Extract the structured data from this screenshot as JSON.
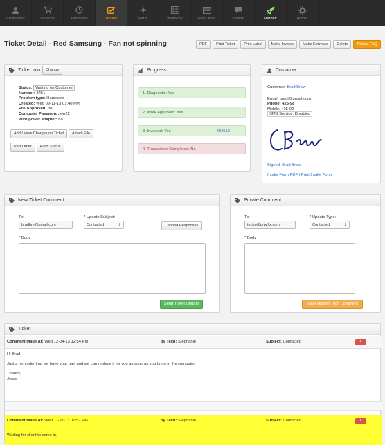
{
  "nav": [
    {
      "label": "Customers",
      "icon": "user-icon"
    },
    {
      "label": "Invoices",
      "icon": "cart-icon"
    },
    {
      "label": "Estimates",
      "icon": "clock-icon"
    },
    {
      "label": "Tickets",
      "icon": "checkbox-icon",
      "active": true
    },
    {
      "label": "Parts",
      "icon": "plane-icon"
    },
    {
      "label": "Inventory",
      "icon": "grid-icon"
    },
    {
      "label": "Field Jobs",
      "icon": "calendar-icon"
    },
    {
      "label": "Leads",
      "icon": "chat-icon"
    },
    {
      "label": "Marketr",
      "icon": "rocket-icon"
    },
    {
      "label": "Admin",
      "icon": "gear-icon"
    }
  ],
  "page": {
    "title": "Ticket Detail - Red Samsung - Fan not spinning"
  },
  "toolbar": [
    "PDF",
    "Print Ticket",
    "Print Label",
    "Make Invoice",
    "Make Estimate",
    "Delete",
    "Tickets FAQ"
  ],
  "ticket_info": {
    "header": "Ticket Info",
    "change": "Change",
    "status_label": "Status:",
    "status_value": "Waiting on Customer",
    "number_label": "Number:",
    "number_value": "3451",
    "problem_label": "Problem type:",
    "problem_value": "Hardware",
    "created_label": "Created:",
    "created_value": "Wed 09-11-13 01:40 PM",
    "preapproved_label": "Pre-Approved:",
    "preapproved_value": "no",
    "password_label": "Computer Password:",
    "password_value": "ew22",
    "adapter_label": "With power adapter:",
    "adapter_value": "no",
    "btn_charges": "Add / View Charges on Ticket",
    "btn_attach": "Attach File",
    "btn_order": "Part Order",
    "btn_status": "Parts Status"
  },
  "progress": {
    "header": "Progress",
    "steps": [
      {
        "label": "1. Diagnostic: Yes",
        "state": "done"
      },
      {
        "label": "2. Work Approved: Yes",
        "state": "done"
      },
      {
        "label": "3. Invoiced: Yes",
        "state": "done",
        "link": "204512"
      },
      {
        "label": "4. Transaction Completed: No",
        "state": "pending"
      }
    ]
  },
  "customer": {
    "header": "Customer",
    "customer_label": "Customer:",
    "customer_name": "Brad Brew",
    "email_label": "Email:",
    "email_value": "bradl@gmail.com",
    "phone_label": "Phone:",
    "phone_value": "425-98",
    "mobile_label": "Mobile:",
    "mobile_value": "425-92",
    "sms": "SMS Service: Disabled",
    "signed_label": "Signed:",
    "signed_name": "Brad Brew",
    "intake_pdf": "Intake Form PDF",
    "sep": "|",
    "print_intake": "Print Intake Form"
  },
  "new_comment": {
    "header": "New Ticket Comment",
    "to_label": "To:",
    "to_value": "bradbre@gmail.com",
    "subject_label": "* Update Subject:",
    "subject_value": "Contacted",
    "canned": "Canned Responses",
    "body_label": "* Body",
    "send": "Send Ticket Update"
  },
  "private_comment": {
    "header": "Private Comment",
    "to_label": "To:",
    "to_value": "techs@drpcfix.com",
    "type_label": "* Update Type:",
    "type_value": "Contacted",
    "body_label": "* Body",
    "save": "Save Hidden Tech Comment"
  },
  "ticket_log": {
    "header": "Ticket",
    "comments": [
      {
        "made_label": "Comment Made At:",
        "made_value": "Wed 12-04-13 12:54 PM",
        "tech_label": "by Tech:",
        "tech_value": "Stephanie",
        "subject_label": "Subject:",
        "subject_value": "Contacted",
        "body": [
          "Hi Brad,",
          "Just a reminder that we have your part and we can replace it for you as soon as you bring in the computer.",
          "Thanks,",
          "Jesse"
        ]
      },
      {
        "made_label": "Comment Made At:",
        "made_value": "Wed 11-27-13 01:57 PM",
        "tech_label": "by Tech:",
        "tech_value": "Stephanie",
        "subject_label": "Subject:",
        "subject_value": "Contacted",
        "body": [
          "Waiting for client to come in."
        ]
      }
    ],
    "delete_glyph": "×"
  },
  "colors": {
    "accent": "#f39c12",
    "nav_bg": "#2b2b2b",
    "highlight": "#ffff33",
    "green": "#5cb85c",
    "danger": "#d9534f"
  }
}
